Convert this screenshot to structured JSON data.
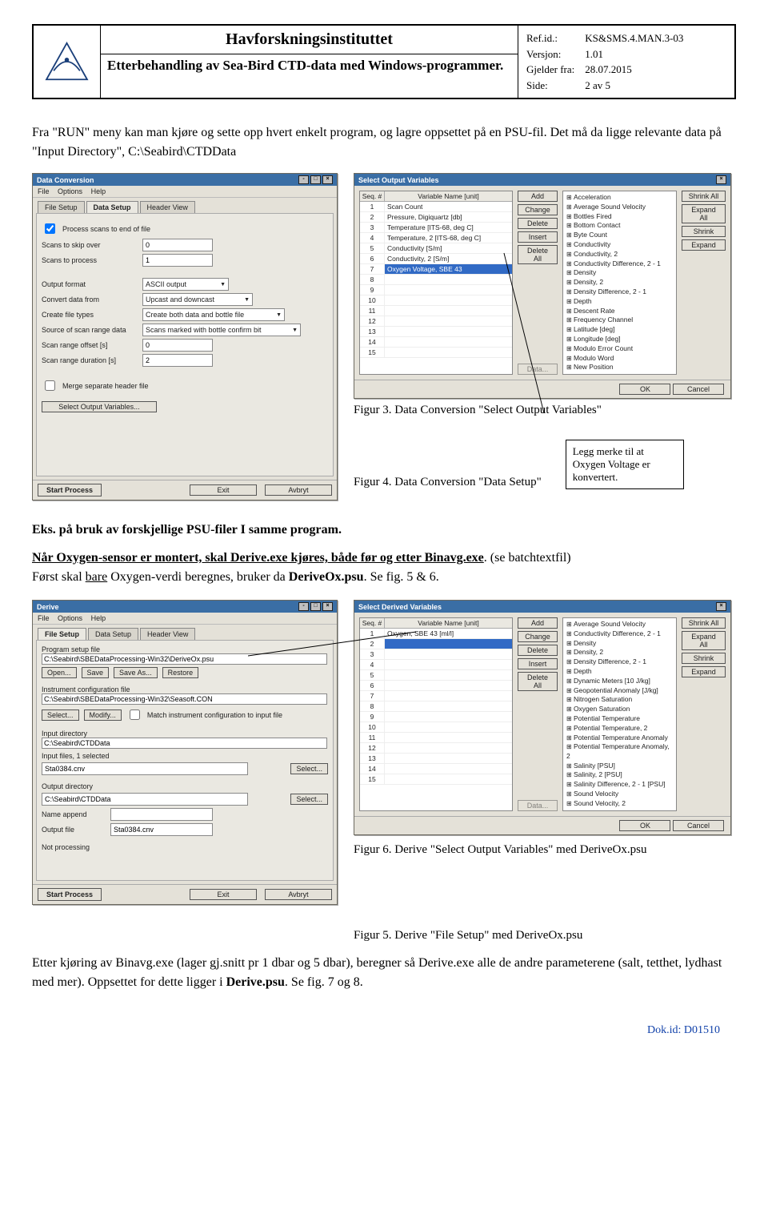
{
  "header": {
    "org": "Havforskningsinstituttet",
    "doc_title": "Etterbehandling av Sea-Bird CTD-data med Windows-programmer.",
    "ref_lbl": "Ref.id.:",
    "ref_val": "KS&SMS.4.MAN.3-03",
    "version_lbl": "Versjon:",
    "version_val": "1.01",
    "from_lbl": "Gjelder fra:",
    "from_val": "28.07.2015",
    "page_lbl": "Side:",
    "page_val": "2 av 5"
  },
  "intro_para": "Fra \"RUN\" meny kan man kjøre og sette opp hvert enkelt program, og lagre oppsettet på en PSU-fil. Det må da ligge relevante data på \"Input Directory\", C:\\Seabird\\CTDData",
  "dc_dialog": {
    "title": "Data Conversion",
    "menu": [
      "File",
      "Options",
      "Help"
    ],
    "tabs": [
      "File Setup",
      "Data Setup",
      "Header View"
    ],
    "rows": {
      "process_scans": "Process scans to end of file",
      "skip_over_lbl": "Scans to skip over",
      "skip_over_val": "0",
      "to_process_lbl": "Scans to process",
      "to_process_val": "1",
      "outfmt_lbl": "Output format",
      "outfmt_val": "ASCII output",
      "convert_lbl": "Convert data from",
      "convert_val": "Upcast and downcast",
      "create_lbl": "Create file types",
      "create_val": "Create both data and bottle file",
      "source_lbl": "Source of scan range data",
      "source_val": "Scans marked with bottle confirm bit",
      "offset_lbl": "Scan range offset [s]",
      "offset_val": "0",
      "dur_lbl": "Scan range duration [s]",
      "dur_val": "2",
      "merge": "Merge separate header file",
      "sel_out": "Select Output Variables..."
    },
    "start": "Start Process",
    "exit": "Exit",
    "cancel": "Avbryt"
  },
  "sov1": {
    "title": "Select Output Variables",
    "th_seq": "Seq. #",
    "th_var": "Variable Name [unit]",
    "rows": [
      "Scan Count",
      "Pressure, Digiquartz [db]",
      "Temperature [ITS-68, deg C]",
      "Temperature, 2 [ITS-68, deg C]",
      "Conductivity [S/m]",
      "Conductivity, 2 [S/m]",
      "Oxygen Voltage, SBE 43",
      "",
      "",
      "",
      "",
      "",
      "",
      "",
      ""
    ],
    "btns": [
      "Add",
      "Change",
      "Delete",
      "Insert",
      "Delete All"
    ],
    "tree": [
      "Acceleration",
      "Average Sound Velocity",
      "Bottles Fired",
      "Bottom Contact",
      "Byte Count",
      "Conductivity",
      "Conductivity, 2",
      "Conductivity Difference, 2 - 1",
      "Density",
      "Density, 2",
      "Density Difference, 2 - 1",
      "Depth",
      "Descent Rate",
      "Frequency Channel",
      "Latitude [deg]",
      "Longitude [deg]",
      "Modulo Error Count",
      "Modulo Word",
      "New Position"
    ],
    "rbtns": [
      "Shrink All",
      "Expand All",
      "Shrink",
      "Expand"
    ],
    "ok": "OK",
    "cancel": "Cancel",
    "data_btn": "Data..."
  },
  "fig3": "Figur 3. Data Conversion \"Select Output Variables\"",
  "fig4": "Figur 4. Data Conversion \"Data Setup\"",
  "callout": "Legg merke til at Oxygen Voltage er konvertert.",
  "section_heading": "Eks. på bruk av forskjellige PSU-filer I samme program.",
  "para2a": "Når Oxygen-sensor er montert, skal Derive.exe kjøres, både før og etter Binavg.exe",
  "para2b": ". (se batchtextfil)",
  "para2c_prefix": "Først skal ",
  "para2c_bare": "bare",
  "para2c_suffix": " Oxygen-verdi beregnes, bruker da ",
  "para2c_bold": "DeriveOx.psu",
  "para2c_end": ". Se fig. 5 & 6.",
  "derive_dialog": {
    "title": "Derive",
    "menu": [
      "File",
      "Options",
      "Help"
    ],
    "tabs": [
      "File Setup",
      "Data Setup",
      "Header View"
    ],
    "progsetup_lbl": "Program setup file",
    "progsetup_val": "C:\\Seabird\\SBEDataProcessing-Win32\\DeriveOx.psu",
    "btns1": [
      "Open...",
      "Save",
      "Save As...",
      "Restore"
    ],
    "instconf_lbl": "Instrument configuration file",
    "instconf_val": "C:\\Seabird\\SBEDataProcessing-Win32\\Seasoft.CON",
    "btns2": [
      "Select...",
      "Modify..."
    ],
    "match_lbl": "Match instrument configuration to input file",
    "inputdir_lbl": "Input directory",
    "inputdir_val": "C:\\Seabird\\CTDData",
    "inputfiles_lbl": "Input files, 1 selected",
    "inputfiles_val": "Sta0384.cnv",
    "select_btn": "Select...",
    "outputdir_lbl": "Output directory",
    "outputdir_val": "C:\\Seabird\\CTDData",
    "nameapp_lbl": "Name append",
    "outfile_lbl": "Output file",
    "outfile_val": "Sta0384.cnv",
    "notproc": "Not processing",
    "start": "Start Process",
    "exit": "Exit",
    "cancel": "Avbryt"
  },
  "sov2": {
    "title": "Select Derived Variables",
    "rows": [
      "Oxygen, SBE 43 [ml/l]",
      "",
      "",
      "",
      "",
      "",
      "",
      "",
      "",
      "",
      "",
      "",
      "",
      "",
      ""
    ],
    "tree": [
      "Average Sound Velocity",
      "Conductivity Difference, 2 - 1",
      "Density",
      "Density, 2",
      "Density Difference, 2 - 1",
      "Depth",
      "Dynamic Meters [10 J/kg]",
      "Geopotential Anomaly [J/kg]",
      "Nitrogen Saturation",
      "Oxygen Saturation",
      "Potential Temperature",
      "Potential Temperature, 2",
      "Potential Temperature Anomaly",
      "Potential Temperature Anomaly, 2",
      "Salinity [PSU]",
      "Salinity, 2 [PSU]",
      "Salinity Difference, 2 - 1 [PSU]",
      "Sound Velocity",
      "Sound Velocity, 2"
    ]
  },
  "fig6": "Figur 6. Derive \"Select Output Variables\" med  DeriveOx.psu",
  "fig5": "Figur 5. Derive \"File Setup\" med DeriveOx.psu",
  "final_para_a": "Etter kjøring av Binavg.exe (lager gj.snitt pr 1 dbar og 5 dbar), beregner så Derive.exe alle de andre parameterene (salt, tetthet, lydhast med mer). Oppsettet for dette ligger i ",
  "final_para_bold": "Derive.psu",
  "final_para_b": ". Se fig. 7 og 8.",
  "footer": "Dok.id: D01510"
}
